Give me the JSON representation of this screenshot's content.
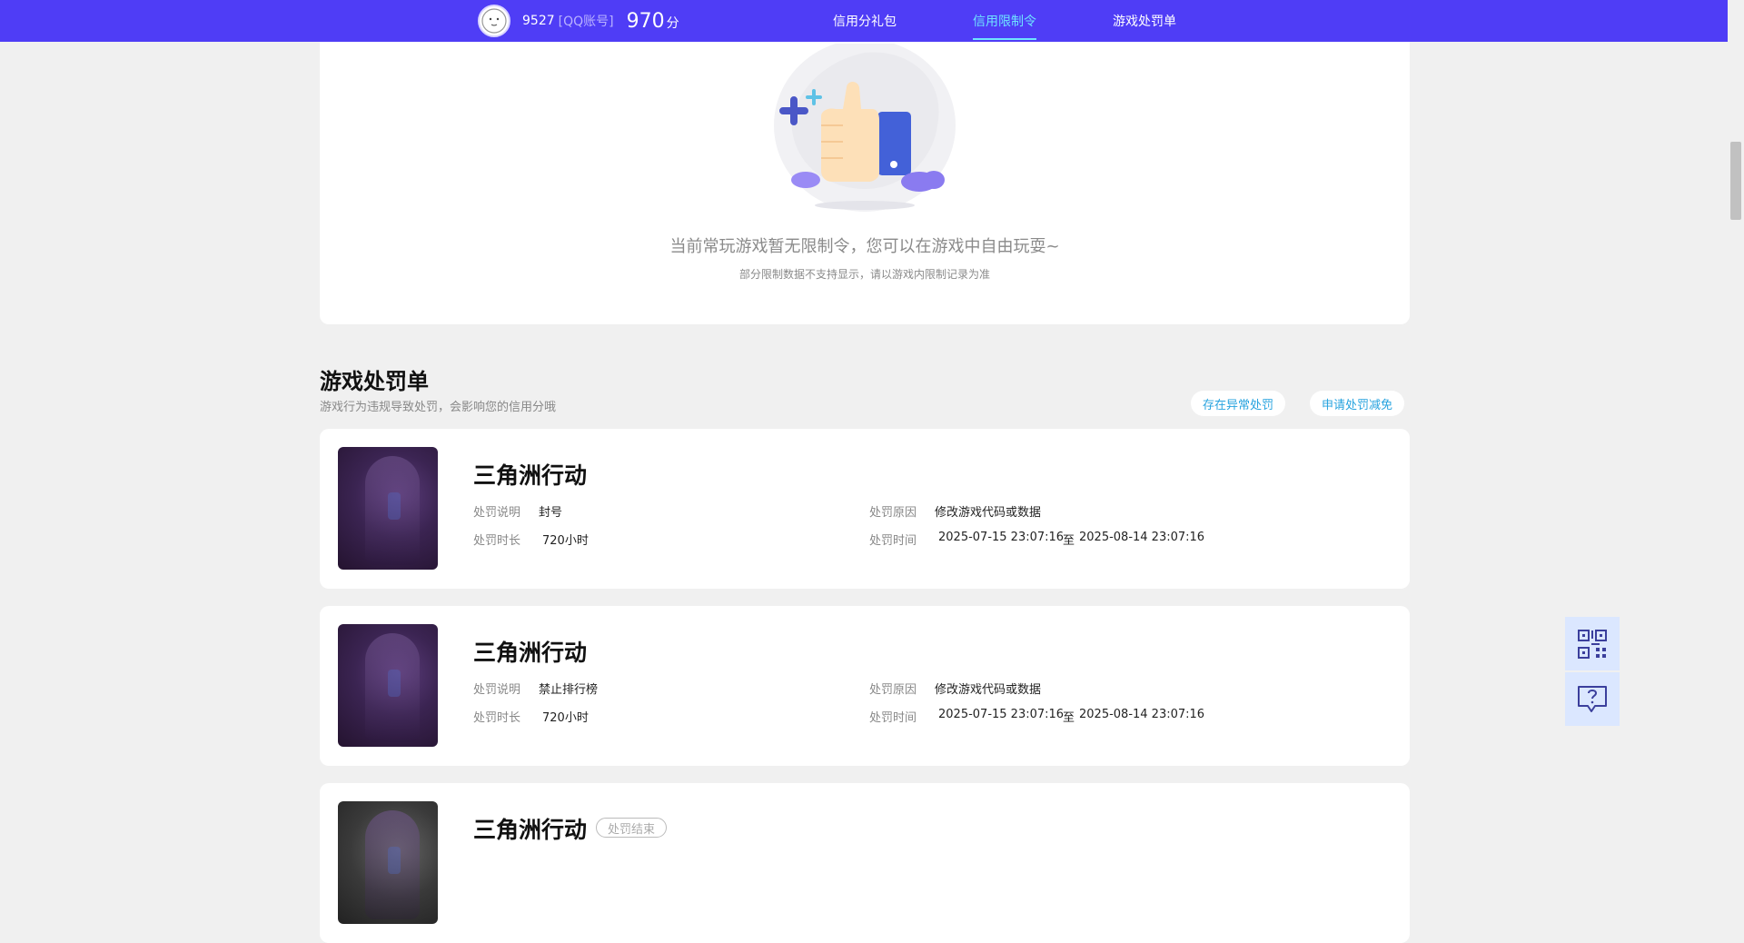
{
  "header": {
    "user_id": "9527",
    "account_type": "[QQ账号]",
    "score": "970",
    "score_unit": "分",
    "nav": [
      {
        "label": "信用分礼包",
        "active": false
      },
      {
        "label": "信用限制令",
        "active": true
      },
      {
        "label": "游戏处罚单",
        "active": false
      }
    ]
  },
  "restriction": {
    "empty_message": "当前常玩游戏暂无限制令，您可以在游戏中自由玩耍~",
    "empty_note": "部分限制数据不支持显示，请以游戏内限制记录为准"
  },
  "penalties": {
    "title": "游戏处罚单",
    "description": "游戏行为违规导致处罚，会影响您的信用分哦",
    "actions": [
      "存在异常处罚",
      "申请处罚减免"
    ],
    "labels": {
      "desc": "处罚说明",
      "reason": "处罚原因",
      "duration": "处罚时长",
      "time": "处罚时间",
      "to": "至"
    },
    "cards": [
      {
        "game": "三角洲行动",
        "desc": "封号",
        "reason": "修改游戏代码或数据",
        "duration": "720小时",
        "start": "2025-07-15 23:07:16",
        "end": "2025-08-14 23:07:16"
      },
      {
        "game": "三角洲行动",
        "desc": "禁止排行榜",
        "reason": "修改游戏代码或数据",
        "duration": "720小时",
        "start": "2025-07-15 23:07:16",
        "end": "2025-08-14 23:07:16"
      },
      {
        "game": "三角洲行动",
        "status": "处罚结束"
      }
    ]
  },
  "float_buttons": [
    {
      "icon": "qr-code-icon"
    },
    {
      "icon": "help-chat-icon"
    }
  ]
}
